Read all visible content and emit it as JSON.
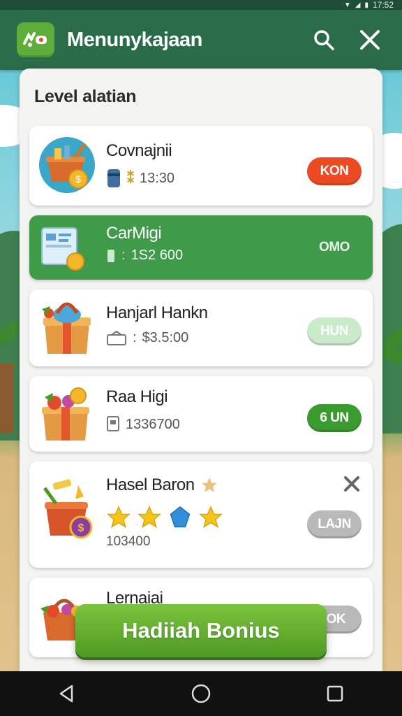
{
  "status_bar": {
    "time": "17:52"
  },
  "app_bar": {
    "title": "Menunykajaan",
    "icons": [
      "app-logo-icon",
      "search-icon",
      "close-icon"
    ]
  },
  "panel": {
    "title": "Level alatian"
  },
  "items": [
    {
      "name": "Covnajnii",
      "meta_icon": "can-icon",
      "meta_value": "13:30",
      "button": "KON",
      "button_color": "#ec4a22",
      "icon": "basket-coin-icon",
      "selected": false
    },
    {
      "name": "CarMigi",
      "meta_icon": "bar-icon",
      "meta_value": "1S2 600",
      "button": "OMO",
      "icon": "paper-coin-icon",
      "selected": true
    },
    {
      "name": "Hanjarl Hankn",
      "meta_icon": "ticket-icon",
      "meta_value": "$3.5:00",
      "button": "HUN",
      "button_color": "#c9ebc9",
      "icon": "gift-box-icon",
      "selected": false
    },
    {
      "name": "Raa Higi",
      "meta_icon": "note-icon",
      "meta_value": "1336700",
      "button": "6 UN",
      "button_color": "#3a9b2e",
      "icon": "fruit-box-icon",
      "selected": false
    },
    {
      "name": "Hasel Baron",
      "meta_value": "103400",
      "button": "LAJN",
      "button_color": "#b9b9b9",
      "icon": "pot-coin-icon",
      "selected": false,
      "has_close": true,
      "stars": [
        "star-icon",
        "star-icon",
        "blue-gem-icon",
        "star-icon"
      ]
    },
    {
      "name": "Lernaiai",
      "button": "IOK",
      "button_color": "#b9b9b9",
      "icon": "fruit-basket-icon",
      "selected": false
    }
  ],
  "bonus_button": {
    "label": "Hadiiah Bonius"
  },
  "nav": {
    "icons": [
      "back-icon",
      "home-icon",
      "recents-icon"
    ]
  }
}
